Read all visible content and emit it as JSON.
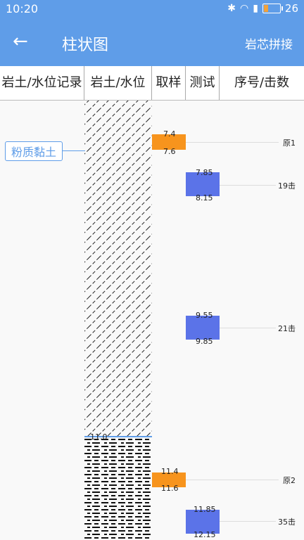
{
  "status": {
    "time": "10:20",
    "battery_level": "26",
    "icons": [
      "bluetooth-icon",
      "wifi-icon",
      "signal-icon",
      "battery-icon"
    ]
  },
  "appbar": {
    "title": "柱状图",
    "action": "岩芯拼接"
  },
  "header": {
    "col1": "岩土/水位记录",
    "col2": "岩土/水位",
    "col3": "取样",
    "col4": "测试",
    "col5": "序号/击数"
  },
  "layer": {
    "name": "粉质黏土",
    "water_level": "11.0"
  },
  "samples": [
    {
      "top": "7.4",
      "bottom": "7.6",
      "label": "原1"
    },
    {
      "top": "11.4",
      "bottom": "11.6",
      "label": "原2"
    }
  ],
  "tests": [
    {
      "top": "7.85",
      "bottom": "8.15",
      "label": "19击"
    },
    {
      "top": "9.55",
      "bottom": "9.85",
      "label": "21击"
    },
    {
      "top": "11.85",
      "bottom": "12.15",
      "label": "35击"
    }
  ],
  "colors": {
    "primary": "#5f9de8",
    "sample": "#f7941d",
    "test": "#5b73e8"
  }
}
